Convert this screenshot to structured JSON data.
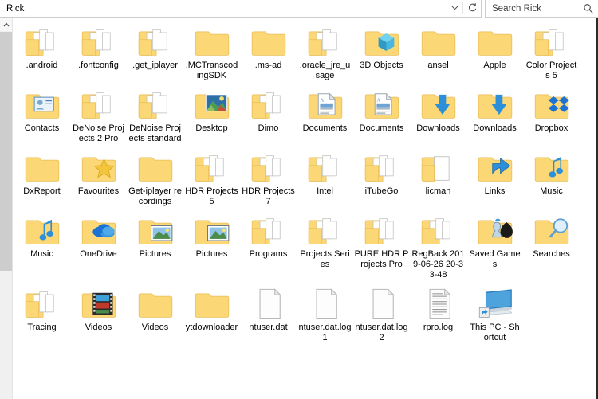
{
  "window": {
    "title": "Rick"
  },
  "addressbar": {
    "path": "Rick",
    "chevron_icon": "chevron-down-icon",
    "refresh_icon": "refresh-icon"
  },
  "search": {
    "placeholder": "Search Rick",
    "icon": "search-icon"
  },
  "scrollbar": {
    "up_arrow": "˄"
  },
  "colors": {
    "folder_front": "#FCD775",
    "folder_back": "#FFE9A8",
    "folder_edge": "#E8BE57",
    "accent_blue": "#2C8FD9",
    "paper": "#FFFFFF",
    "paper_edge": "#BFBFBF",
    "window_bg": "#FFFFFF",
    "scrollbar_track": "#F0F0F0",
    "scrollbar_thumb": "#CDCDCD",
    "text": "#000000"
  },
  "items": [
    {
      "label": ".android",
      "icon": "folder-papers-icon",
      "type": "folder"
    },
    {
      "label": ".fontconfig",
      "icon": "folder-papers-icon",
      "type": "folder"
    },
    {
      "label": ".get_iplayer",
      "icon": "folder-papers-icon",
      "type": "folder"
    },
    {
      "label": ".MCTranscodingSDK",
      "icon": "folder-empty-icon",
      "type": "folder"
    },
    {
      "label": ".ms-ad",
      "icon": "folder-empty-icon",
      "type": "folder"
    },
    {
      "label": ".oracle_jre_usage",
      "icon": "folder-papers-icon",
      "type": "folder"
    },
    {
      "label": "3D Objects",
      "icon": "folder-3d-cube-icon",
      "type": "folder"
    },
    {
      "label": "ansel",
      "icon": "folder-empty-icon",
      "type": "folder"
    },
    {
      "label": "Apple",
      "icon": "folder-empty-icon",
      "type": "folder"
    },
    {
      "label": "Color Projects 5",
      "icon": "folder-papers-icon",
      "type": "folder"
    },
    {
      "label": "Contacts",
      "icon": "folder-contacts-icon",
      "type": "folder"
    },
    {
      "label": "DeNoise Projects 2 Pro",
      "icon": "folder-papers-icon",
      "type": "folder"
    },
    {
      "label": "DeNoise Projects standard",
      "icon": "folder-papers-icon",
      "type": "folder"
    },
    {
      "label": "Desktop",
      "icon": "folder-desktop-icon",
      "type": "folder"
    },
    {
      "label": "Dimo",
      "icon": "folder-papers-icon",
      "type": "folder"
    },
    {
      "label": "Documents",
      "icon": "folder-documents-icon",
      "type": "folder"
    },
    {
      "label": "Documents",
      "icon": "folder-documents-icon",
      "type": "folder"
    },
    {
      "label": "Downloads",
      "icon": "folder-downloads-icon",
      "type": "folder"
    },
    {
      "label": "Downloads",
      "icon": "folder-downloads-icon",
      "type": "folder"
    },
    {
      "label": "Dropbox",
      "icon": "folder-dropbox-icon",
      "type": "folder"
    },
    {
      "label": "DxReport",
      "icon": "folder-empty-icon",
      "type": "folder"
    },
    {
      "label": "Favourites",
      "icon": "folder-star-icon",
      "type": "folder"
    },
    {
      "label": "Get-iplayer recordings",
      "icon": "folder-empty-icon",
      "type": "folder"
    },
    {
      "label": "HDR Projects 5",
      "icon": "folder-papers-icon",
      "type": "folder"
    },
    {
      "label": "HDR Projects 7",
      "icon": "folder-papers-icon",
      "type": "folder"
    },
    {
      "label": "Intel",
      "icon": "folder-papers-icon",
      "type": "folder"
    },
    {
      "label": "iTubeGo",
      "icon": "folder-papers-icon",
      "type": "folder"
    },
    {
      "label": "licman",
      "icon": "folder-paper-single-icon",
      "type": "folder"
    },
    {
      "label": "Links",
      "icon": "folder-links-icon",
      "type": "folder"
    },
    {
      "label": "Music",
      "icon": "folder-music-icon",
      "type": "folder"
    },
    {
      "label": "Music",
      "icon": "folder-music-icon",
      "type": "folder"
    },
    {
      "label": "OneDrive",
      "icon": "folder-onedrive-icon",
      "type": "folder"
    },
    {
      "label": "Pictures",
      "icon": "folder-pictures-icon",
      "type": "folder"
    },
    {
      "label": "Pictures",
      "icon": "folder-pictures-icon",
      "type": "folder"
    },
    {
      "label": "Programs",
      "icon": "folder-papers-icon",
      "type": "folder"
    },
    {
      "label": "Projects Series",
      "icon": "folder-papers-icon",
      "type": "folder"
    },
    {
      "label": "PURE HDR Projects Pro",
      "icon": "folder-papers-icon",
      "type": "folder"
    },
    {
      "label": "RegBack 2019-06-26 20-33-48",
      "icon": "folder-papers-icon",
      "type": "folder"
    },
    {
      "label": "Saved Games",
      "icon": "folder-chess-icon",
      "type": "folder"
    },
    {
      "label": "Searches",
      "icon": "folder-search-icon",
      "type": "folder"
    },
    {
      "label": "Tracing",
      "icon": "folder-papers-icon",
      "type": "folder"
    },
    {
      "label": "Videos",
      "icon": "folder-film-icon",
      "type": "folder"
    },
    {
      "label": "Videos",
      "icon": "folder-empty-icon",
      "type": "folder"
    },
    {
      "label": "ytdownloader",
      "icon": "folder-empty-icon",
      "type": "folder"
    },
    {
      "label": "ntuser.dat",
      "icon": "file-blank-icon",
      "type": "file"
    },
    {
      "label": "ntuser.dat.log1",
      "icon": "file-blank-icon",
      "type": "file"
    },
    {
      "label": "ntuser.dat.log2",
      "icon": "file-blank-icon",
      "type": "file"
    },
    {
      "label": "rpro.log",
      "icon": "file-log-icon",
      "type": "file"
    },
    {
      "label": "This PC - Shortcut",
      "icon": "shortcut-thispc-icon",
      "type": "shortcut"
    }
  ],
  "layout": {
    "columns": 10,
    "rows": 5
  }
}
